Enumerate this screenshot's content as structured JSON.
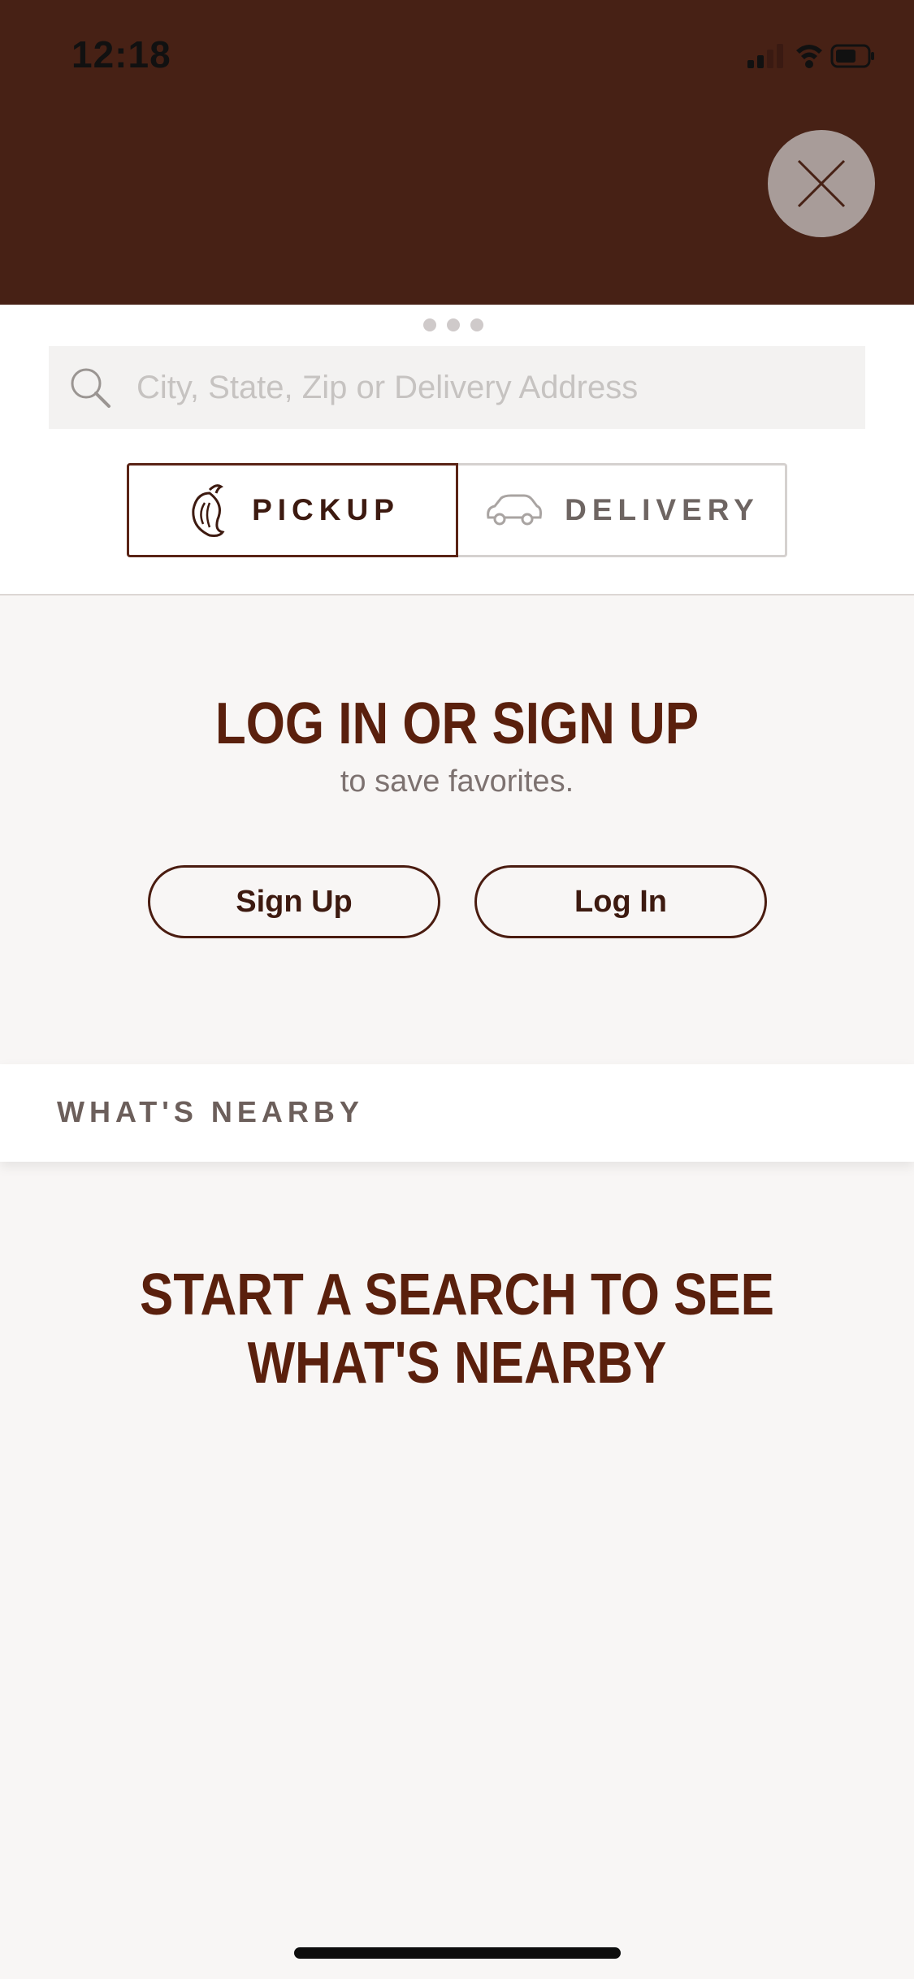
{
  "status_bar": {
    "time": "12:18"
  },
  "search": {
    "placeholder": "City, State, Zip or Delivery Address"
  },
  "order_type": {
    "pickup_label": "PICKUP",
    "delivery_label": "DELIVERY",
    "selected": "PICKUP"
  },
  "login_prompt": {
    "title": "LOG IN OR SIGN UP",
    "subtitle": "to save favorites.",
    "signup_label": "Sign Up",
    "login_label": "Log In"
  },
  "nearby": {
    "header": "WHAT'S NEARBY",
    "empty_line1": "START A SEARCH TO SEE",
    "empty_line2": "WHAT'S NEARBY"
  },
  "icons": {
    "close": "close-icon",
    "search": "search-icon",
    "pickup": "pepper-icon",
    "delivery": "car-icon"
  },
  "colors": {
    "header_bg": "#472115",
    "brand_brown": "#5a200d",
    "page_bg": "#f8f6f5"
  }
}
